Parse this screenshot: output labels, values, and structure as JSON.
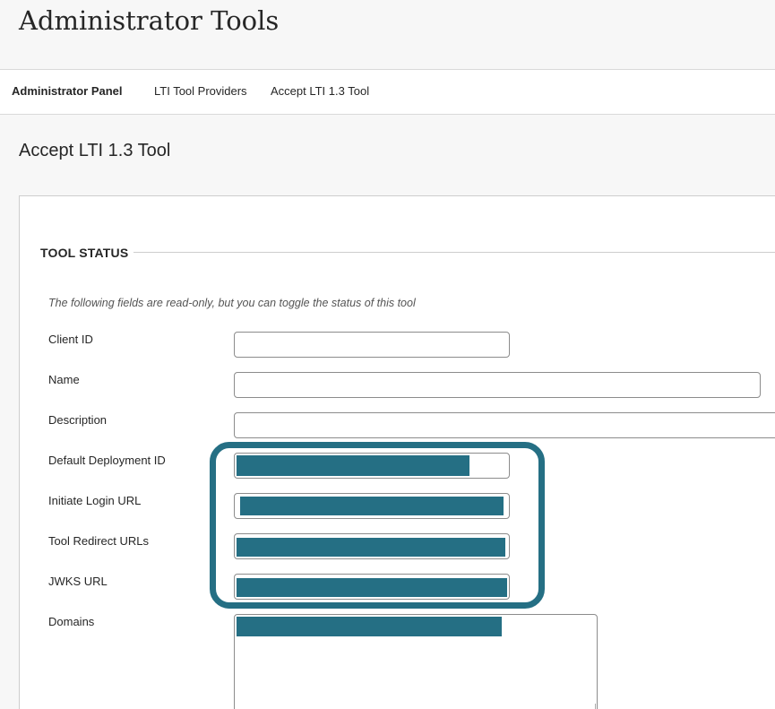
{
  "header": {
    "title": "Administrator Tools"
  },
  "nav": {
    "items": [
      {
        "label": "Administrator Panel",
        "active": true
      },
      {
        "label": "LTI Tool Providers",
        "active": false
      },
      {
        "label": "Accept LTI 1.3 Tool",
        "active": false
      }
    ]
  },
  "main": {
    "page_title": "Accept LTI 1.3 Tool",
    "section": {
      "title": "TOOL STATUS",
      "help_text": "The following fields are read-only, but you can toggle the status of this tool",
      "fields": [
        {
          "label": "Client ID",
          "value": ""
        },
        {
          "label": "Name",
          "value": ""
        },
        {
          "label": "Description",
          "value": ""
        },
        {
          "label": "Default Deployment ID",
          "value": "",
          "redacted": true
        },
        {
          "label": "Initiate Login URL",
          "value": "",
          "redacted": true
        },
        {
          "label": "Tool Redirect URLs",
          "value": "",
          "redacted": true
        },
        {
          "label": "JWKS URL",
          "value": "",
          "redacted": true
        },
        {
          "label": "Domains",
          "value": "",
          "redacted": true
        }
      ]
    }
  },
  "colors": {
    "header_bg": "#f7f7f7",
    "redaction": "#256f84",
    "highlight": "#256f84"
  }
}
